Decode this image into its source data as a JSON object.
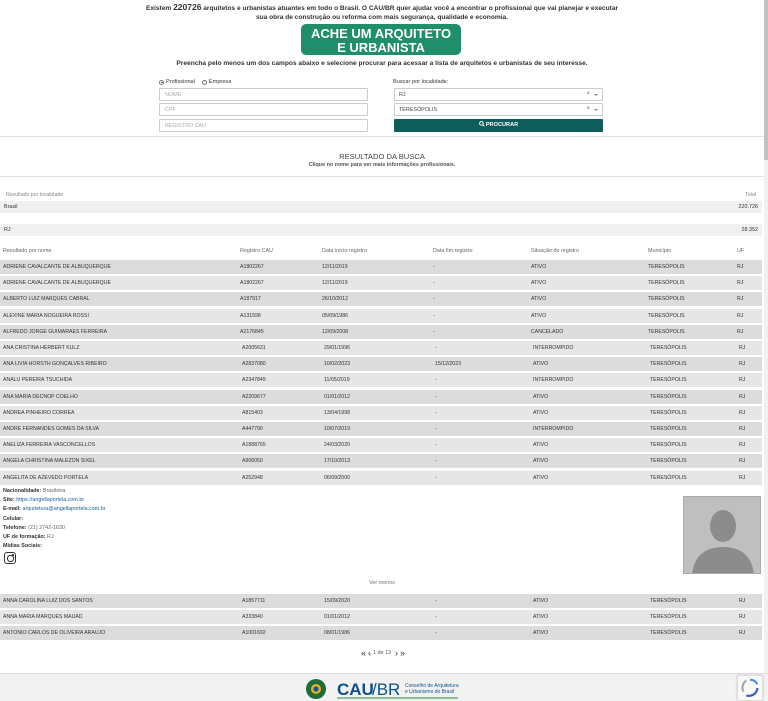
{
  "intro": {
    "prefix": "Existem ",
    "count": "220726",
    "line1_rest": " arquitetos e urbanistas atuantes em todo o Brasil. O CAU/BR quer ajudar você a encontrar o profissional que vai planejar e executar",
    "line2": "sua obra de construção ou reforma com mais segurança, qualidade e economia."
  },
  "banner": {
    "line1": "ACHE UM ARQUITETO",
    "line2": "E URBANISTA"
  },
  "fill_hint": "Preencha pelo menos um dos campos abaixo e selecione procurar para acessar a lista de arquitetos e urbanistas de seu interesse.",
  "form": {
    "radio_profissional": "Profissional",
    "radio_empresa": "Empresa",
    "nome_placeholder": "NOME",
    "cpf_placeholder": "CPF",
    "cau_placeholder": "REGISTRO CAU",
    "loc_label": "Buscar por localidade:",
    "uf_value": "RJ",
    "city_value": "TERESÓPOLIS",
    "clear_symbol": "×",
    "search_label": "PROCURAR"
  },
  "result": {
    "title": "RESULTADO DA BUSCA",
    "subtitle": "Clique no nome para ver mais informações profissionais."
  },
  "loc_table": {
    "header_left": "Resultado por localidade",
    "header_right": "Total",
    "rows": [
      {
        "name": "Brasil",
        "total": "220.726"
      },
      {
        "name": "RJ",
        "total": "28.352"
      }
    ]
  },
  "table": {
    "headers": [
      "Resultado por nome",
      "Registro CAU",
      "Data início registro",
      "Data fim registro",
      "Situação do registro",
      "Município",
      "UF"
    ],
    "rows_top": [
      [
        "ADRIENE CAVALCANTE DE ALBUQUERQUE",
        "A1802267",
        "12/11/2019",
        "-",
        "ATIVO",
        "TERESÓPOLIS",
        "RJ"
      ],
      [
        "ADRIENE CAVALCANTE DE ALBUQUERQUE",
        "A1802267",
        "12/11/2019",
        "-",
        "ATIVO",
        "TERESÓPOLIS",
        "RJ"
      ],
      [
        "ALBERTO LUIZ MARQUES CABRAL",
        "A187917",
        "26/10/2012",
        "-",
        "ATIVO",
        "TERESÓPOLIS",
        "RJ"
      ],
      [
        "ALEXINE MARIA NOGUEIRA ROSSI",
        "A131598",
        "05/09/1986",
        "-",
        "ATIVO",
        "TERESÓPOLIS",
        "RJ"
      ],
      [
        "ALFREDO JORGE GUIMARAES FERREIRA",
        "A2176845",
        "12/09/2008",
        "-",
        "CANCELADO",
        "TERESÓPOLIS",
        "RJ"
      ],
      [
        "ANA CRISTINA HERBERT KULZ",
        "A2005631",
        "29/01/1996",
        "-",
        "INTERROMPIDO",
        "TERESÓPOLIS",
        "RJ"
      ],
      [
        "ANA LIVIA HORSTH GONÇALVES RIBEIRO",
        "A2837080",
        "10/02/2023",
        "15/12/2023",
        "ATIVO",
        "TERESÓPOLIS",
        "RJ"
      ],
      [
        "ANALU PEREIRA TSUCHIDA",
        "A2347849",
        "11/05/2019",
        "-",
        "INTERROMPIDO",
        "TERESÓPOLIS",
        "RJ"
      ],
      [
        "ANA MARIA DECNOP COELHO",
        "A2209677",
        "01/01/2012",
        "-",
        "ATIVO",
        "TERESÓPOLIS",
        "RJ"
      ],
      [
        "ANDREA PINHEIRO CORREA",
        "A815403",
        "13/04/1998",
        "-",
        "ATIVO",
        "TERESÓPOLIS",
        "RJ"
      ],
      [
        "ANDRE FERNANDES GOMES DA SILVA",
        "A447790",
        "10/07/2019",
        "-",
        "INTERROMPIDO",
        "TERESÓPOLIS",
        "RJ"
      ],
      [
        "ANELIZA FERREIRA VASCONCELLOS",
        "A1888765",
        "24/03/2020",
        "-",
        "ATIVO",
        "TERESÓPOLIS",
        "RJ"
      ],
      [
        "ANGELA CHRISTINA MALEZON SIXEL",
        "A906050",
        "17/10/2013",
        "-",
        "ATIVO",
        "TERESÓPOLIS",
        "RJ"
      ],
      [
        "ANGELITA DE AZEVEDO PORTELA",
        "A252948",
        "06/09/2000",
        "-",
        "ATIVO",
        "TERESÓPOLIS",
        "RJ"
      ]
    ],
    "rows_bottom": [
      [
        "ANNA CAROLINA LUIZ DOS SANTOS",
        "A1857711",
        "15/09/2020",
        "-",
        "ATIVO",
        "TERESÓPOLIS",
        "RJ"
      ],
      [
        "ANNA MARIA MARQUES MAUAD",
        "A333840",
        "01/01/2012",
        "-",
        "ATIVO",
        "TERESÓPOLIS",
        "RJ"
      ],
      [
        "ANTONIO CARLOS DE OLIVEIRA ARAUJO",
        "A1001692",
        "08/01/1986",
        "-",
        "ATIVO",
        "TERESÓPOLIS",
        "RJ"
      ]
    ]
  },
  "details": {
    "nacionalidade_label": "Nacionalidade:",
    "nacionalidade": "Brasileira",
    "site_label": "Site:",
    "site": "https://angellaportela.com.br",
    "email_label": "E-mail:",
    "email": "arquitetura@angellaportela.com.br",
    "celular_label": "Celular:",
    "telefone_label": "Telefone:",
    "telefone": "(21) 2742-1630",
    "uf_label": "UF de formação:",
    "uf": "RJ",
    "midias_label": "Mídias Sociais:",
    "see_less": "Ver menos"
  },
  "pager": {
    "first": "«",
    "prev": "‹",
    "info": "1 de 13",
    "next": "›",
    "last": "»"
  },
  "footer": {
    "logo_text": "CAU",
    "logo_br": "/BR",
    "logo_sub1": "Conselho de Arquitetura",
    "logo_sub2": "e Urbanismo do Brasil"
  },
  "colors": {
    "brand_green": "#0d5e5a",
    "banner_green": "#1f8f6b",
    "link": "#1a5ea3"
  }
}
